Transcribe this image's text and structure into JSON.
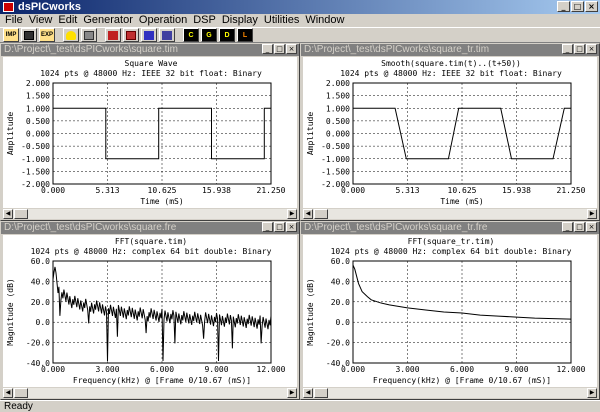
{
  "app": {
    "title": "dsPICworks"
  },
  "menu": [
    "File",
    "View",
    "Edit",
    "Generator",
    "Operation",
    "DSP",
    "Display",
    "Utilities",
    "Window"
  ],
  "toolbar": {
    "buttons": [
      {
        "name": "import",
        "label": "IMP"
      },
      {
        "name": "save",
        "label": ""
      },
      {
        "name": "export",
        "label": "EXP"
      },
      {
        "name": "help",
        "label": ""
      },
      {
        "name": "print",
        "label": ""
      },
      {
        "name": "tool-a",
        "label": ""
      },
      {
        "name": "tool-b",
        "label": ""
      },
      {
        "name": "tool-c",
        "label": ""
      },
      {
        "name": "tool-d",
        "label": ""
      },
      {
        "name": "c",
        "label": "C"
      },
      {
        "name": "g",
        "label": "G"
      },
      {
        "name": "d",
        "label": "D"
      },
      {
        "name": "l",
        "label": "L"
      }
    ]
  },
  "status": {
    "text": "Ready"
  },
  "windows": [
    {
      "title": "D:\\Project\\_test\\dsPICworks\\square.tim",
      "heading": "Square Wave",
      "info": "1024 pts @ 48000 Hz: IEEE 32 bit float: Binary",
      "xlabel": "Time (mS)",
      "ylabel": "Amplitude"
    },
    {
      "title": "D:\\Project\\_test\\dsPICworks\\square_tr.tim",
      "heading": "Smooth(square.tim(t)..(t+50))",
      "info": "1024 pts @ 48000 Hz: IEEE 32 bit float: Binary",
      "xlabel": "Time (mS)",
      "ylabel": "Amplitude"
    },
    {
      "title": "D:\\Project\\_test\\dsPICworks\\square.fre",
      "heading": "FFT(square.tim)",
      "info": "1024 pts @ 48000 Hz: complex 64 bit double: Binary",
      "xlabel": "Frequency(kHz) @ [Frame 0/10.67 (mS)]",
      "ylabel": "Magnitude (dB)"
    },
    {
      "title": "D:\\Project\\_test\\dsPICworks\\square_tr.fre",
      "heading": "FFT(square_tr.tim)",
      "info": "1024 pts @ 48000 Hz: complex 64 bit double: Binary",
      "xlabel": "Frequency(kHz) @ [Frame 0/10.67 (mS)]",
      "ylabel": "Magnitude (dB)"
    }
  ],
  "chart_data": [
    {
      "type": "line",
      "title": "Square Wave",
      "xlabel": "Time (mS)",
      "ylabel": "Amplitude",
      "xlim": [
        0,
        21.25
      ],
      "ylim": [
        -2,
        2
      ],
      "xticks": [
        "0.000",
        "5.313",
        "10.625",
        "15.938",
        "21.250"
      ],
      "yticks": [
        "2.000",
        "1.500",
        "1.000",
        "0.500",
        "0.000",
        "-0.500",
        "-1.000",
        "-1.500",
        "-2.000"
      ],
      "grid": true,
      "x": [
        0,
        5.15,
        5.15,
        10.3,
        10.3,
        15.45,
        15.45,
        20.6,
        20.6,
        21.25
      ],
      "y": [
        1,
        1,
        -1,
        -1,
        1,
        1,
        -1,
        -1,
        1,
        1
      ]
    },
    {
      "type": "line",
      "title": "Smooth(square.tim(t)..(t+50))",
      "xlabel": "Time (mS)",
      "ylabel": "Amplitude",
      "xlim": [
        0,
        21.25
      ],
      "ylim": [
        -2,
        2
      ],
      "xticks": [
        "0.000",
        "5.313",
        "10.625",
        "15.938",
        "21.250"
      ],
      "yticks": [
        "2.000",
        "1.500",
        "1.000",
        "0.500",
        "0.000",
        "-0.500",
        "-1.000",
        "-1.500",
        "-2.000"
      ],
      "grid": true,
      "x": [
        0,
        4.1,
        5.2,
        9.3,
        10.3,
        14.4,
        15.45,
        19.5,
        20.6,
        21.25
      ],
      "y": [
        1,
        1,
        -1,
        -1,
        1,
        1,
        -1,
        -1,
        1,
        1
      ]
    },
    {
      "type": "line",
      "title": "FFT(square.tim)",
      "xlabel": "Frequency(kHz) @ [Frame 0/10.67 (mS)]",
      "ylabel": "Magnitude (dB)",
      "xlim": [
        0,
        12
      ],
      "ylim": [
        -40,
        60
      ],
      "xticks": [
        "0.000",
        "3.000",
        "6.000",
        "9.000",
        "12.000"
      ],
      "yticks": [
        "60.0",
        "40.0",
        "20.0",
        "0.0",
        "-20.0",
        "-40.0"
      ],
      "grid": true,
      "x": [
        0,
        0.1,
        0.3,
        0.5,
        0.8,
        1.0,
        1.5,
        2.0,
        2.5,
        3.0,
        3.5,
        4.0,
        5.0,
        6.0,
        7.0,
        8.0,
        9.0,
        10.0,
        11.0,
        12.0
      ],
      "y": [
        42,
        55,
        38,
        33,
        30,
        27,
        24,
        22,
        21,
        19,
        17,
        16,
        14,
        13,
        11,
        10,
        9,
        8,
        7,
        6
      ],
      "noisy": true,
      "dips": [
        3.0,
        6.05,
        9.1
      ]
    },
    {
      "type": "line",
      "title": "FFT(square_tr.tim)",
      "xlabel": "Frequency(kHz) @ [Frame 0/10.67 (mS)]",
      "ylabel": "Magnitude (dB)",
      "xlim": [
        0,
        12
      ],
      "ylim": [
        -40,
        60
      ],
      "xticks": [
        "0.000",
        "3.000",
        "6.000",
        "9.000",
        "12.000"
      ],
      "yticks": [
        "60.0",
        "40.0",
        "20.0",
        "0.0",
        "-20.0",
        "-40.0"
      ],
      "grid": true,
      "x": [
        0,
        0.1,
        0.3,
        0.5,
        0.8,
        1.0,
        1.5,
        2.0,
        3.0,
        4.0,
        5.0,
        6.0,
        7.0,
        8.0,
        9.0,
        10.0,
        11.0,
        12.0
      ],
      "y": [
        56,
        52,
        38,
        30,
        25,
        22,
        19,
        17,
        14,
        12,
        10,
        9,
        7,
        6,
        5,
        4,
        3.5,
        3
      ],
      "noisy": false,
      "dips": []
    }
  ]
}
